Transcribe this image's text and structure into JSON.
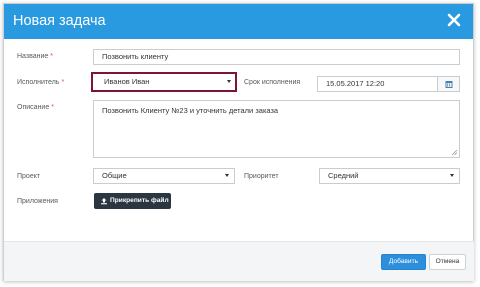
{
  "dialog": {
    "title": "Новая задача",
    "close_icon": "close-icon"
  },
  "form": {
    "name_label": "Название",
    "name_value": "Позвонить клиенту",
    "assignee_label": "Исполнитель",
    "assignee_value": "Иванов Иван",
    "due_label": "Срок исполнения",
    "due_value": "15.05.2017 12:20",
    "description_label": "Описание",
    "description_value": "Позвонить Клиенту №23 и уточнить детали заказа",
    "project_label": "Проект",
    "project_value": "Общие",
    "priority_label": "Приоритет",
    "priority_value": "Средний",
    "attachments_label": "Приложения",
    "attach_button": "Прикрепить файл",
    "required_mark": "*"
  },
  "footer": {
    "add_button": "Добавить",
    "cancel_button": "Отмена"
  },
  "colors": {
    "header": "#2a9ae0",
    "highlight": "#7d1433",
    "primary_button": "#2d8fdc",
    "attach_button": "#2b3640"
  }
}
